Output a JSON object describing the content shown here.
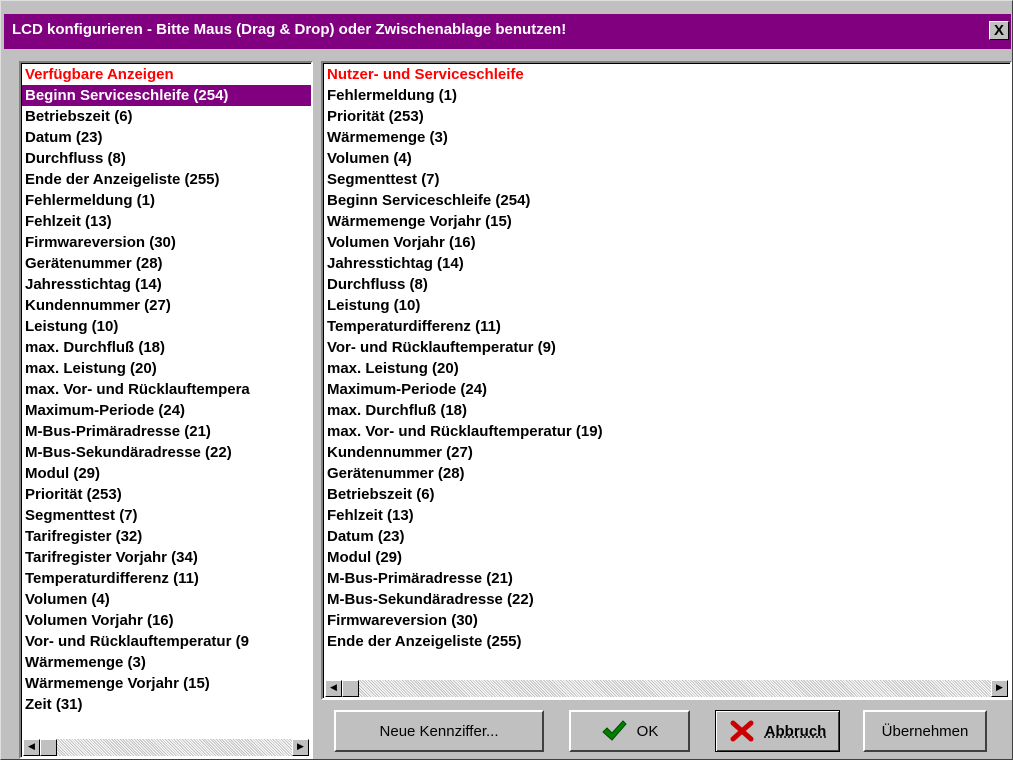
{
  "window": {
    "title": "LCD konfigurieren - Bitte Maus (Drag & Drop) oder Zwischenablage benutzen!",
    "close_label": "X"
  },
  "left_list": {
    "header": "Verfügbare Anzeigen",
    "selected_index": 0,
    "items": [
      "Beginn Serviceschleife (254)",
      "Betriebszeit (6)",
      "Datum (23)",
      "Durchfluss (8)",
      "Ende der Anzeigeliste (255)",
      "Fehlermeldung (1)",
      "Fehlzeit (13)",
      "Firmwareversion (30)",
      "Gerätenummer (28)",
      "Jahresstichtag (14)",
      "Kundennummer (27)",
      "Leistung (10)",
      "max. Durchfluß (18)",
      "max. Leistung (20)",
      "max. Vor- und Rücklauftempera",
      "Maximum-Periode (24)",
      "M-Bus-Primäradresse (21)",
      "M-Bus-Sekundäradresse (22)",
      "Modul (29)",
      "Priorität (253)",
      "Segmenttest (7)",
      "Tarifregister (32)",
      "Tarifregister Vorjahr (34)",
      "Temperaturdifferenz (11)",
      "Volumen (4)",
      "Volumen Vorjahr (16)",
      "Vor- und Rücklauftemperatur (9",
      "Wärmemenge (3)",
      "Wärmemenge Vorjahr (15)",
      "Zeit (31)"
    ]
  },
  "right_list": {
    "header": "Nutzer- und Serviceschleife",
    "items": [
      "Fehlermeldung (1)",
      "Priorität (253)",
      "Wärmemenge (3)",
      "Volumen (4)",
      "Segmenttest (7)",
      "Beginn Serviceschleife (254)",
      "Wärmemenge Vorjahr (15)",
      "Volumen Vorjahr (16)",
      "Jahresstichtag (14)",
      "Durchfluss (8)",
      "Leistung (10)",
      "Temperaturdifferenz (11)",
      "Vor- und Rücklauftemperatur (9)",
      "max. Leistung (20)",
      "Maximum-Periode (24)",
      "max. Durchfluß (18)",
      "max. Vor- und Rücklauftemperatur (19)",
      "Kundennummer (27)",
      "Gerätenummer (28)",
      "Betriebszeit (6)",
      "Fehlzeit (13)",
      "Datum (23)",
      "Modul (29)",
      "M-Bus-Primäradresse (21)",
      "M-Bus-Sekundäradresse (22)",
      "Firmwareversion (30)",
      "Ende der Anzeigeliste (255)"
    ]
  },
  "buttons": {
    "neue_label": "Neue Kennziffer...",
    "ok_label": "OK",
    "abbruch_label": "Abbruch",
    "uebernehmen_label": "Übernehmen"
  },
  "scrollbar": {
    "left_arrow": "◀",
    "right_arrow": "▶"
  },
  "colors": {
    "titlebar": "#800080",
    "selection": "#800080",
    "header_text": "#ff0000",
    "ok_icon": "#008000",
    "cancel_icon": "#cc0000"
  },
  "icons": {
    "ok": "checkmark-icon",
    "cancel": "x-cross-icon"
  }
}
